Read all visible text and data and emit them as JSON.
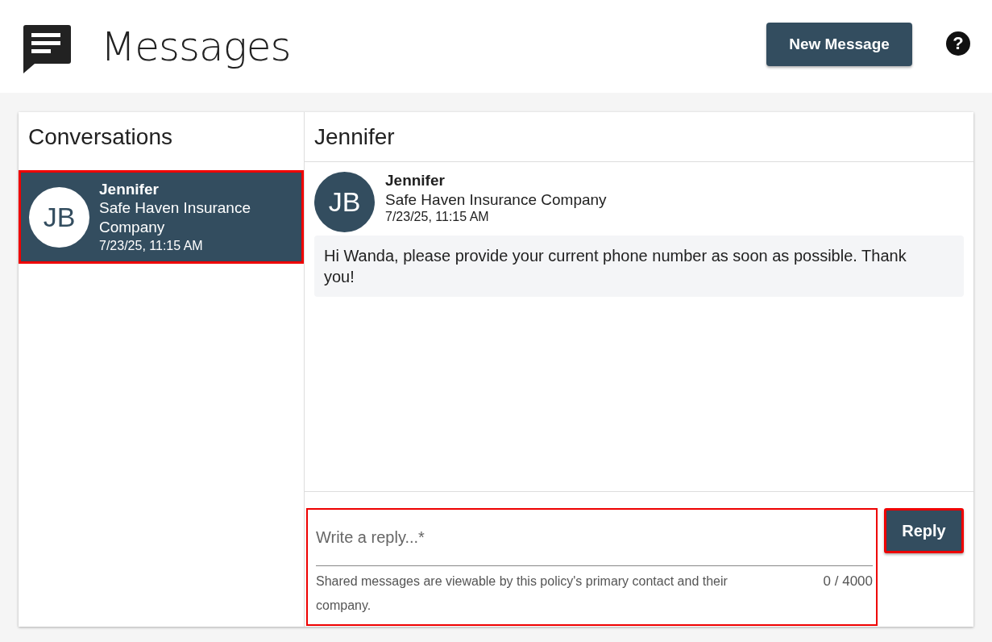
{
  "header": {
    "title": "Messages",
    "new_button": "New Message",
    "help_icon": "?"
  },
  "conversations": {
    "title": "Conversations",
    "items": [
      {
        "initials": "JB",
        "name": "Jennifer",
        "company": "Safe Haven Insurance Company",
        "time": "7/23/25, 11:15 AM",
        "selected": true
      }
    ]
  },
  "thread": {
    "title": "Jennifer",
    "messages": [
      {
        "initials": "JB",
        "name": "Jennifer",
        "company": "Safe Haven Insurance Company",
        "time": "7/23/25, 11:15 AM",
        "text": "Hi Wanda, please provide your current phone number as soon as possible. Thank you!"
      }
    ]
  },
  "composer": {
    "placeholder": "Write a reply...*",
    "hint": "Shared messages are viewable by this policy's primary contact and their company.",
    "counter": "0 / 4000",
    "reply_button": "Reply"
  }
}
